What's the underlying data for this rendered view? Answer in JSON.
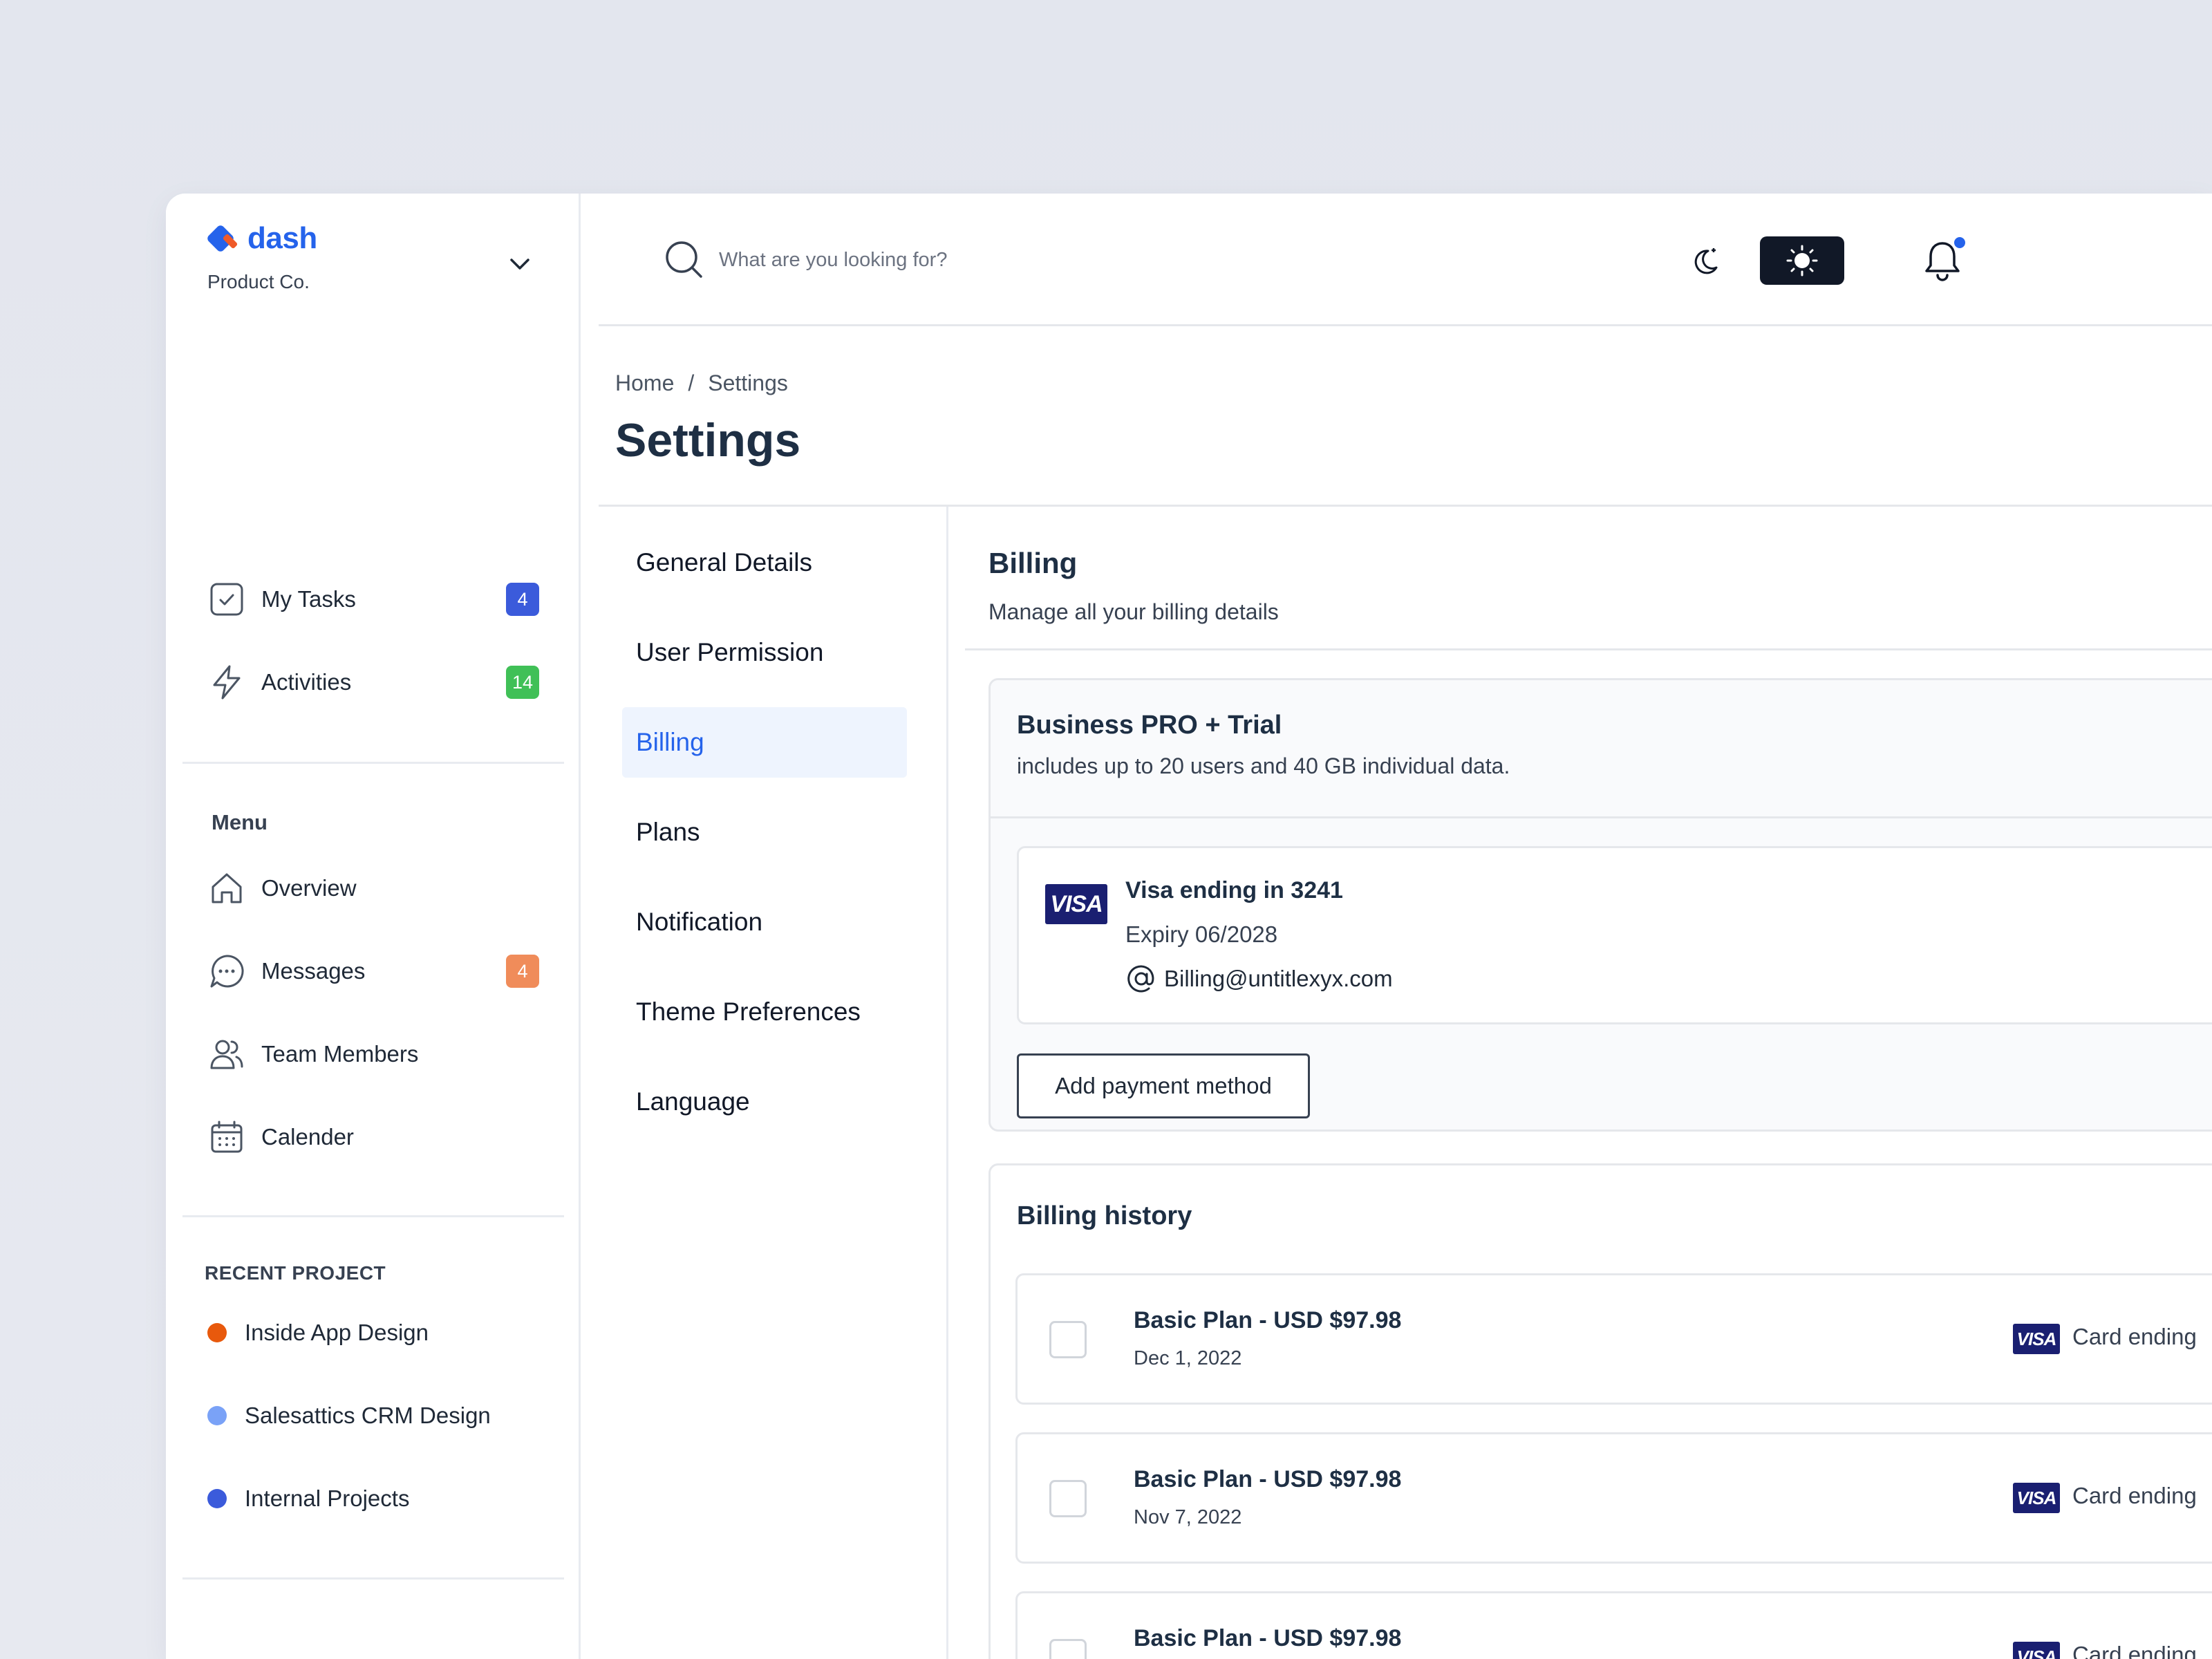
{
  "brand": {
    "name": "dash",
    "org": "Product Co."
  },
  "sidebar": {
    "top_items": [
      {
        "label": "My Tasks",
        "badge": "4",
        "badge_color": "#3b5bdb"
      },
      {
        "label": "Activities",
        "badge": "14",
        "badge_color": "#40c057"
      }
    ],
    "menu_title": "Menu",
    "menu_items": [
      {
        "label": "Overview",
        "badge": ""
      },
      {
        "label": "Messages",
        "badge": "4",
        "badge_color": "#f08c5a"
      },
      {
        "label": "Team Members",
        "badge": ""
      },
      {
        "label": "Calender",
        "badge": ""
      }
    ],
    "recent_title": "RECENT PROJECT",
    "projects": [
      {
        "label": "Inside App Design",
        "color": "#e8590c"
      },
      {
        "label": "Salesattics CRM Design",
        "color": "#7aa2f7"
      },
      {
        "label": "Internal Projects",
        "color": "#3b5bdb"
      }
    ]
  },
  "search": {
    "placeholder": "What are you looking for?"
  },
  "breadcrumb": {
    "home": "Home",
    "separator": "/",
    "current": "Settings"
  },
  "page_title": "Settings",
  "settings_nav": {
    "items": [
      "General Details",
      "User Permission",
      "Billing",
      "Plans",
      "Notification",
      "Theme Preferences",
      "Language"
    ],
    "active": "Billing"
  },
  "billing": {
    "title": "Billing",
    "subtitle": "Manage all your billing details",
    "plan_name": "Business PRO + Trial",
    "plan_desc": "includes up to 20 users and 40 GB individual data.",
    "card": {
      "brand": "VISA",
      "title": "Visa ending in 3241",
      "expiry": "Expiry 06/2028",
      "email": "Billing@untitlexyx.com"
    },
    "add_payment": "Add payment method",
    "history_title": "Billing history",
    "history": [
      {
        "title": "Basic Plan - USD $97.98",
        "date": "Dec 1, 2022",
        "card_text": "Card ending"
      },
      {
        "title": "Basic Plan - USD $97.98",
        "date": "Nov 7, 2022",
        "card_text": "Card ending"
      },
      {
        "title": "Basic Plan - USD $97.98",
        "date": "",
        "card_text": "Card ending"
      }
    ]
  },
  "colors": {
    "accent": "#2563eb",
    "title": "#1e2f44",
    "visa": "#1a1f71",
    "active_bg": "#eef4fe"
  }
}
